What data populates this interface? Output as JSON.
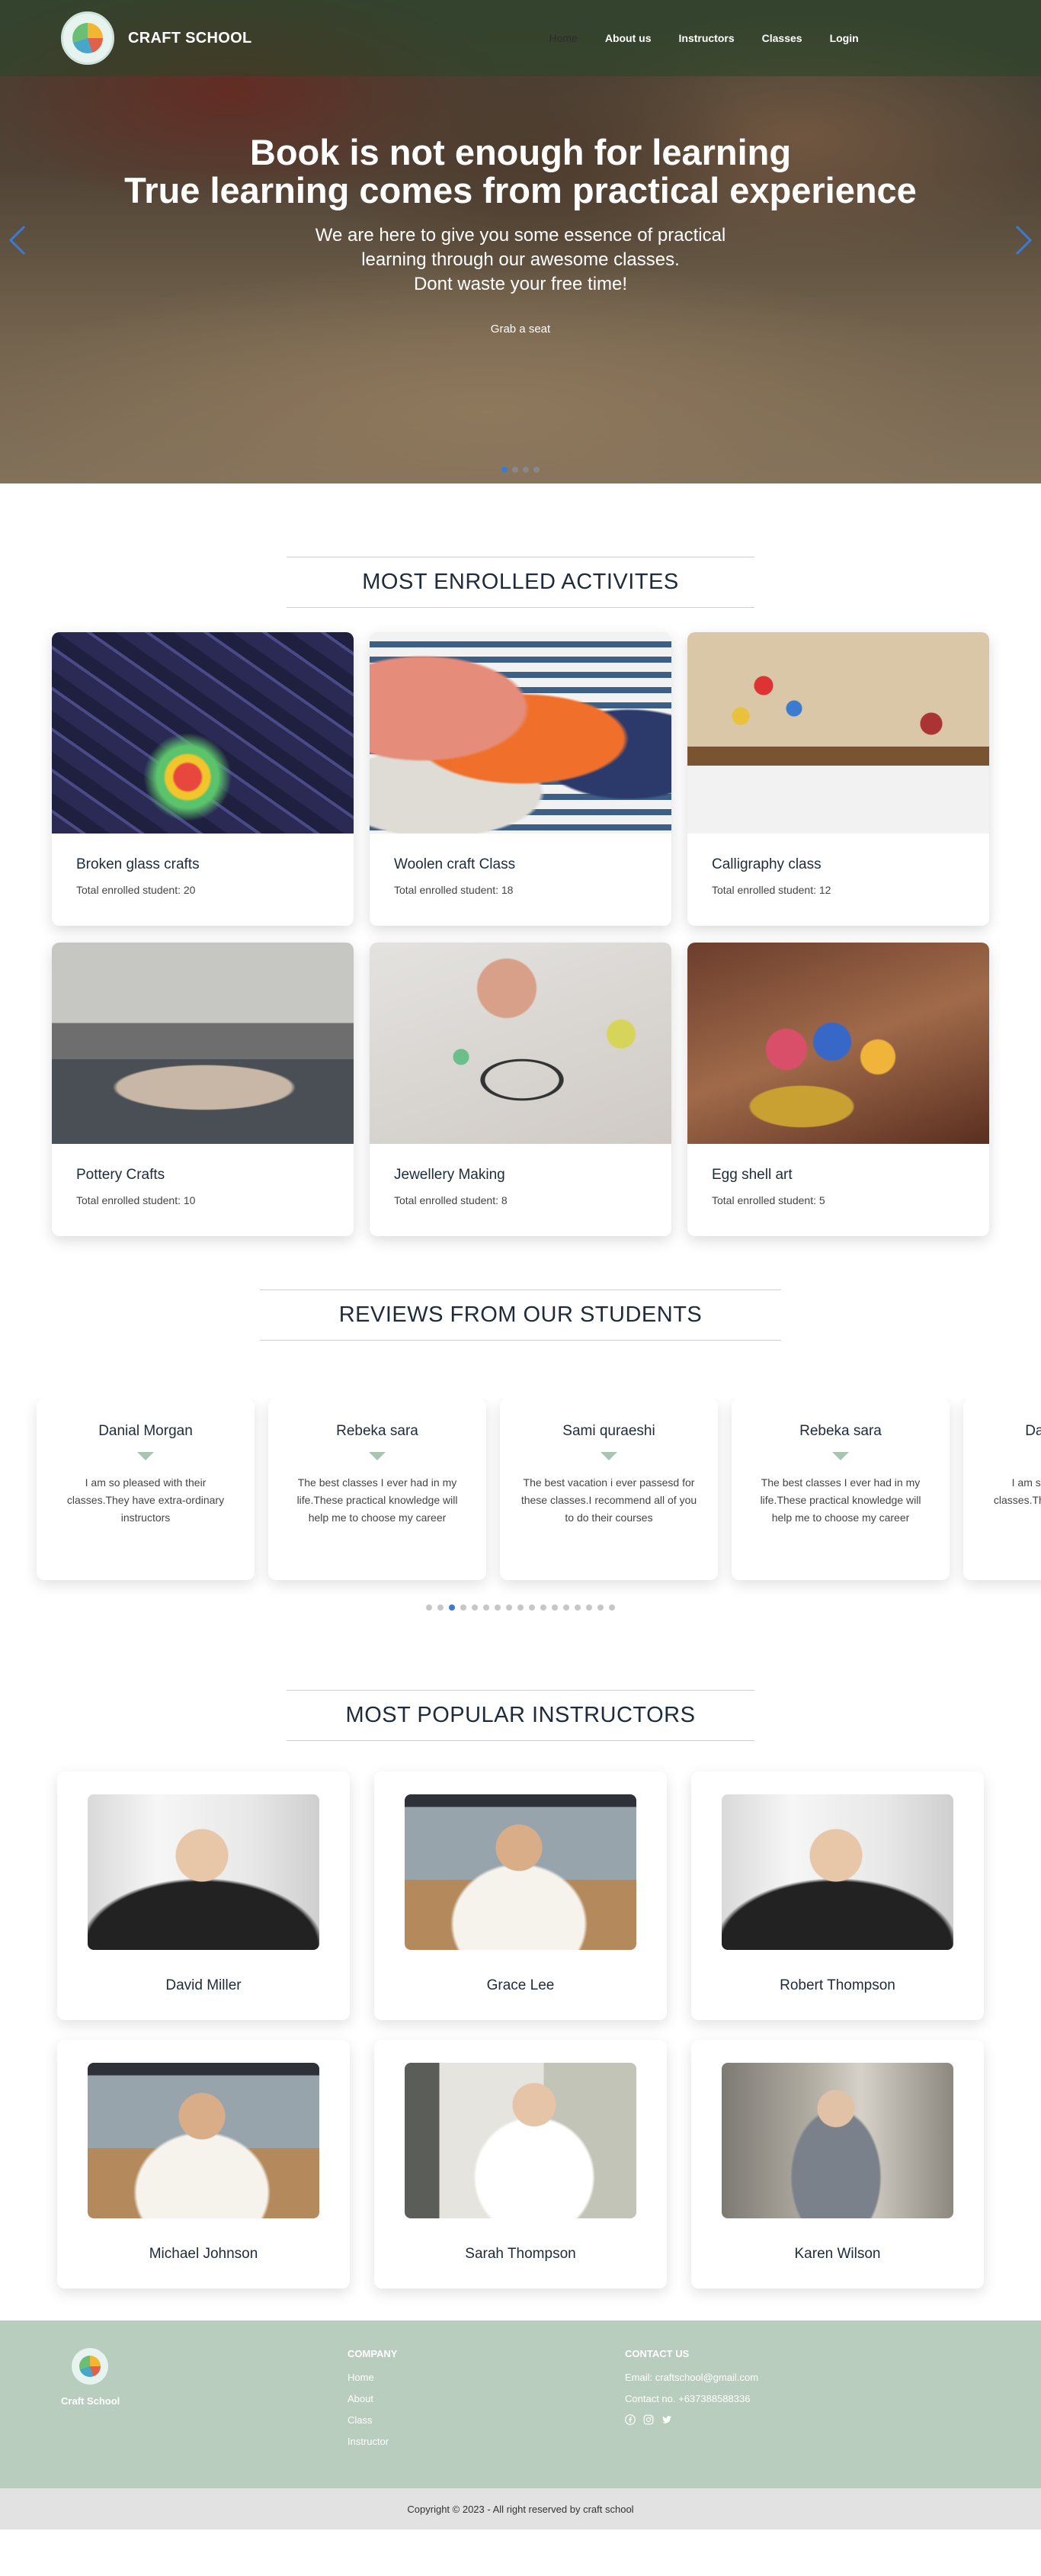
{
  "nav": {
    "brand": "CRAFT SCHOOL",
    "links": [
      "Home",
      "About us",
      "Instructors",
      "Classes",
      "Login"
    ]
  },
  "hero": {
    "title_line1": "Book is not enough for learning",
    "title_line2": "True learning comes from practical experience",
    "sub_line1": "We are here to give you some essence of practical",
    "sub_line2": "learning through our awesome classes.",
    "sub_line3": "Dont waste your free time!",
    "button": "Grab a seat",
    "slide_count": 4,
    "active_slide": 1
  },
  "activities": {
    "title": "MOST ENROLLED ACTIVITES",
    "items": [
      {
        "name": "Broken glass crafts",
        "count": "Total enrolled student: 20"
      },
      {
        "name": "Woolen craft Class",
        "count": "Total enrolled student: 18"
      },
      {
        "name": "Calligraphy class",
        "count": "Total enrolled student: 12"
      },
      {
        "name": "Pottery Crafts",
        "count": "Total enrolled student: 10"
      },
      {
        "name": "Jewellery Making",
        "count": "Total enrolled student: 8"
      },
      {
        "name": "Egg shell art",
        "count": "Total enrolled student: 5"
      }
    ]
  },
  "reviews": {
    "title": "REVIEWS FROM OUR STUDENTS",
    "items": [
      {
        "name": "Danial Morgan",
        "text": "I am so pleased with their classes.They have extra-ordinary instructors"
      },
      {
        "name": "Rebeka sara",
        "text": "The best classes I ever had in my life.These practical knowledge will help me to choose my career"
      },
      {
        "name": "Sami quraeshi",
        "text": "The best vacation i ever passesd for these classes.I recommend all of you to do their courses"
      },
      {
        "name": "Rebeka sara",
        "text": "The best classes I ever had in my life.These practical knowledge will help me to choose my career"
      },
      {
        "name": "Danial Morgan",
        "text": "I am so pleased with their classes.They have extra-ordinary instructors"
      }
    ],
    "dot_count": 17,
    "active_dot": 3
  },
  "instructors": {
    "title": "MOST POPULAR INSTRUCTORS",
    "items": [
      {
        "name": "David Miller"
      },
      {
        "name": "Grace Lee"
      },
      {
        "name": "Robert Thompson"
      },
      {
        "name": "Michael Johnson"
      },
      {
        "name": "Sarah Thompson"
      },
      {
        "name": "Karen Wilson"
      }
    ]
  },
  "footer": {
    "brand": "Craft School",
    "company_head": "COMPANY",
    "company_links": [
      "Home",
      "About",
      "Class",
      "Instructor"
    ],
    "contact_head": "CONTACT US",
    "email": "Email: craftschool@gmail.com",
    "phone": "Contact no. +637388588336",
    "social_icons": [
      "facebook-icon",
      "instagram-icon",
      "twitter-icon"
    ],
    "copyright": "Copyright © 2023 - All right reserved by craft school"
  },
  "colors": {
    "accent": "#3a7bd5",
    "footer_bg": "#b9cdbe",
    "copyright_bg": "#e2e2e2"
  }
}
